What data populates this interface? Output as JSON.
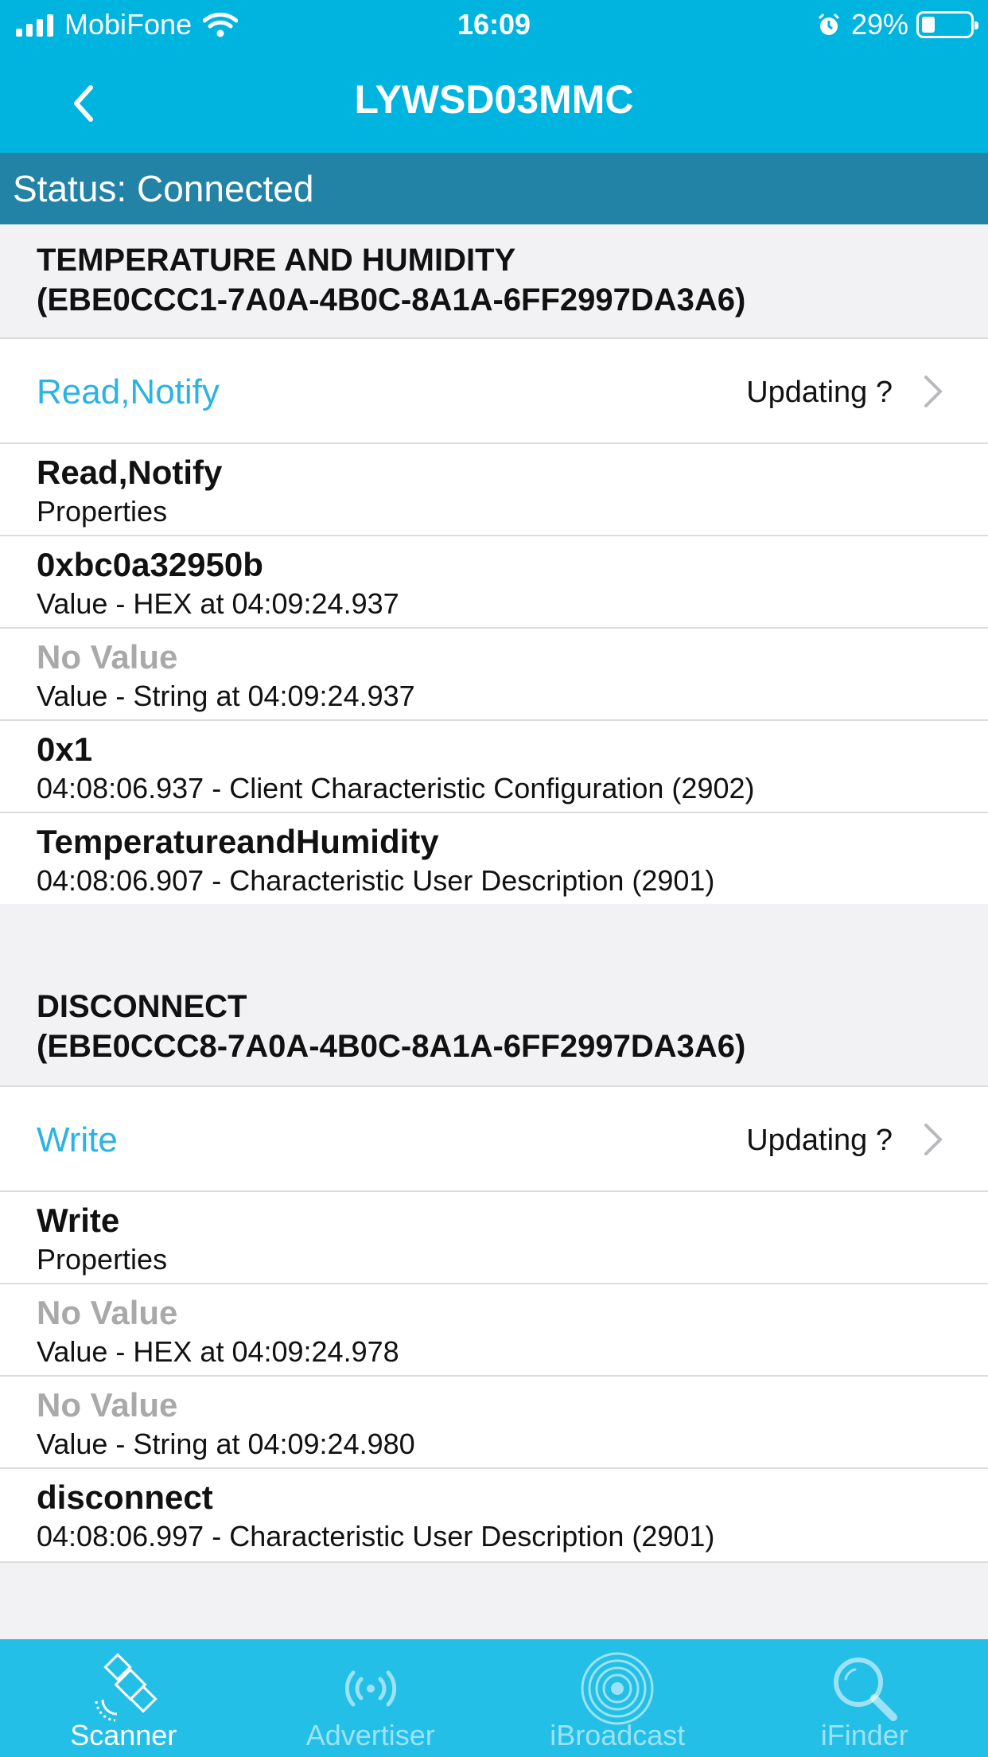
{
  "status_bar": {
    "carrier": "MobiFone",
    "time": "16:09",
    "battery": "29%",
    "battery_level": 0.29
  },
  "nav": {
    "title": "LYWSD03MMC"
  },
  "connection": {
    "status": "Status: Connected"
  },
  "services": [
    {
      "title_line1": "TEMPERATURE AND HUMIDITY",
      "title_line2": "(EBE0CCC1-7A0A-4B0C-8A1A-6FF2997DA3A6)",
      "characteristic": {
        "name": "Read,Notify",
        "updating": "Updating ?"
      },
      "items": [
        {
          "value": "Read,Notify",
          "desc": "Properties"
        },
        {
          "value": "0xbc0a32950b",
          "desc": "Value - HEX at 04:09:24.937"
        },
        {
          "value": "No Value",
          "desc": "Value - String at 04:09:24.937"
        },
        {
          "value": "0x1",
          "desc": "04:08:06.937 - Client Characteristic Configuration (2902)"
        },
        {
          "value": "TemperatureandHumidity",
          "desc": "04:08:06.907 - Characteristic User Description (2901)"
        }
      ]
    },
    {
      "title_line1": "DISCONNECT",
      "title_line2": "(EBE0CCC8-7A0A-4B0C-8A1A-6FF2997DA3A6)",
      "characteristic": {
        "name": "Write",
        "updating": "Updating ?"
      },
      "items": [
        {
          "value": "Write",
          "desc": "Properties"
        },
        {
          "value": "No Value",
          "desc": "Value - HEX at 04:09:24.978"
        },
        {
          "value": "No Value",
          "desc": "Value - String at 04:09:24.980"
        },
        {
          "value": "disconnect",
          "desc": "04:08:06.997 - Characteristic User Description (2901)"
        }
      ]
    }
  ],
  "tabs": [
    {
      "label": "Scanner",
      "icon": "satellite-icon"
    },
    {
      "label": "Advertiser",
      "icon": "broadcast-icon"
    },
    {
      "label": "iBroadcast",
      "icon": "rings-icon"
    },
    {
      "label": "iFinder",
      "icon": "magnifier-icon"
    }
  ],
  "colors": {
    "header": "#00b4e0",
    "status_strip": "#2383a6",
    "accent": "#2bb3e3",
    "tabbar": "#24bfe6"
  }
}
